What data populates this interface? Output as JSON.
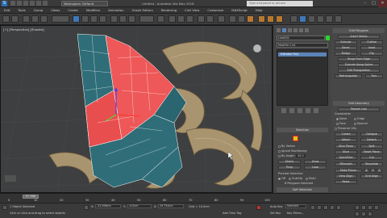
{
  "titlebar": {
    "workspace": "Workspace: Default",
    "title": "Untitled - Autodesk 3ds Max 2016",
    "search_placeholder": "Type a keyword or phrase",
    "minimize": "–",
    "maximize": "□",
    "close": "✕"
  },
  "menubar": {
    "items": [
      "Edit",
      "Tools",
      "Group",
      "Views",
      "Create",
      "Modifiers",
      "Animation",
      "Graph Editors",
      "Rendering",
      "Civil View",
      "Customize",
      "MAXScript",
      "Help"
    ]
  },
  "viewport": {
    "label": "[+] [Perspective] [Shaded]"
  },
  "command_panel": {
    "object_name": "Line001",
    "object_color": "#2fd12f",
    "modifier_list": "Modifier List",
    "stack_item": "Editable Poly",
    "selection_title": "Selection",
    "by_vertex": "By Vertex",
    "ignore_backfacing": "Ignore Backfacing",
    "by_angle": "By Angle:",
    "angle_value": "45.0",
    "shrink": "Shrink",
    "grow": "Grow",
    "ring": "Ring",
    "loop": "Loop",
    "preview_selection": "Preview Selection",
    "off": "Off",
    "subobj": "SubObj",
    "multi": "Multi",
    "polys_selected": "8 Polygons Selected",
    "soft_selection": "Soft Selection"
  },
  "edit_polygons": {
    "title": "Edit Polygons",
    "insert_vertex": "Insert Vertex",
    "extrude": "Extrude",
    "outline": "Outline",
    "bevel": "Bevel",
    "inset": "Inset",
    "bridge": "Bridge",
    "flip": "Flip",
    "hinge": "Hinge From Edge",
    "extrude_spline": "Extrude Along Spline",
    "edit_tri": "Edit Triangulation",
    "retriangulate": "Retriangulate",
    "turn": "Turn",
    "edit_geometry": "Edit Geometry",
    "repeat_last": "Repeat Last",
    "constraints": "Constraints",
    "none": "None",
    "edge": "Edge",
    "face": "Face",
    "normal": "Normal",
    "preserve_uvs": "Preserve UVs",
    "create": "Create",
    "collapse": "Collapse",
    "attach": "Attach",
    "detach": "Detach",
    "slice_plane": "Slice Plane",
    "split": "Split",
    "slice": "Slice",
    "reset_plane": "Reset Plane",
    "quickslice": "QuickSlice",
    "cut": "Cut",
    "msmooth": "MSmooth",
    "tessellate": "Tessellate",
    "make_planar": "Make Planar",
    "view_align": "View Align",
    "grid_align": "Grid Align",
    "relax": "Relax",
    "x": "X",
    "y": "Y",
    "z": "Z"
  },
  "timeline": {
    "frame": "0 / 100",
    "ticks": [
      "0",
      "10",
      "20",
      "30",
      "40",
      "50",
      "60",
      "70",
      "80",
      "90",
      "100"
    ]
  },
  "statusbar": {
    "selected": "1 Object Selected",
    "prompt": "Click or click-and-drag to select objects",
    "x_label": "X:",
    "x_val": "-22.996cm",
    "y_label": "Y:",
    "y_val": "-0.0cm",
    "z_label": "Z:",
    "z_val": "29.754cm",
    "grid": "Grid = 10.0cm",
    "add_time_tag": "Add Time Tag",
    "auto_key": "Auto Key",
    "set_key": "Set Key",
    "selected_dd": "Selected",
    "key_filters": "Key Filters..."
  }
}
